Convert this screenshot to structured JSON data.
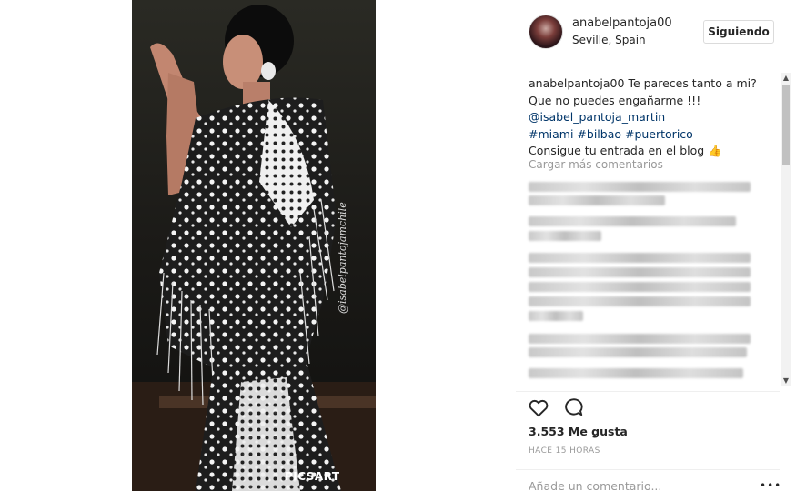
{
  "post": {
    "username": "anabelpantoja00",
    "location": "Seville, Spain",
    "follow_label": "Siguiendo",
    "watermark_vertical": "@isabelpantojamchile",
    "watermark_bottom": "PICSART"
  },
  "caption": {
    "user": "anabelpantoja00",
    "line1": "Te pareces tanto a mi?",
    "line2": "Que no puedes engañarme !!!",
    "mention": "@isabel_pantoja_martin",
    "hashtags": "#miami #bilbao #puertorico",
    "line5": "Consigue tu entrada en el blog 👍"
  },
  "comments": {
    "load_more": "Cargar más comentarios"
  },
  "actions": {
    "likes": "3.553 Me gusta",
    "time": "HACE 15 HORAS",
    "add_comment_placeholder": "Añade un comentario...",
    "more_options": "•••"
  },
  "icons": {
    "like": "heart-icon",
    "comment": "comment-icon",
    "scroll_up": "scroll-up-arrow-icon",
    "scroll_down": "scroll-down-arrow-icon"
  },
  "colors": {
    "link": "#003569",
    "muted": "#999999",
    "text": "#262626",
    "border": "#dbdbdb"
  }
}
